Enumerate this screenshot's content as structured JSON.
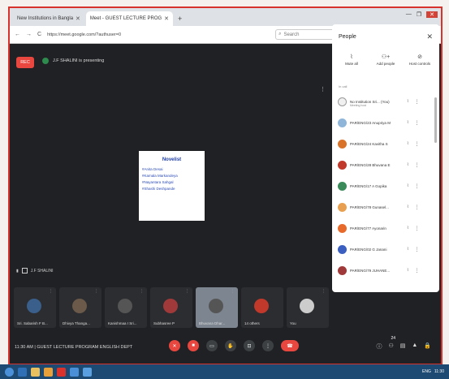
{
  "browser": {
    "tabs": [
      {
        "label": "New Institutions in Bangla",
        "active": false
      },
      {
        "label": "Meet - GUEST LECTURE PROG",
        "active": true
      }
    ],
    "new_tab": "+",
    "window_controls": [
      "—",
      "❐",
      "✕"
    ],
    "url": "https://meet.google.com/?authuser=0",
    "search_placeholder": "Search",
    "nav": [
      "←",
      "→",
      "C"
    ]
  },
  "meet": {
    "record_label": "REC",
    "presenting_text": "J.F SHALINI is presenting",
    "presenter_tag": "J.F SHALINI",
    "slide": {
      "title": "Novelist",
      "items": [
        "#Anita Desai",
        "#Kamala Markandeya",
        "#Nayantara Sahgal",
        "#Shashi Deshpande"
      ]
    },
    "tiles": [
      {
        "name": "Sri. Sabarish F B...",
        "color": "#3a5f8a"
      },
      {
        "name": "Dhivya Thanga...",
        "color": "#6b5a4a"
      },
      {
        "name": "Kanishmaa I Sri...",
        "color": "#555555"
      },
      {
        "name": "Subhasree P",
        "color": "#a03a3a"
      },
      {
        "name": "Bhuvana Dhar...",
        "color": "#7c8590"
      },
      {
        "name": "14 others",
        "color": "#c0392b"
      },
      {
        "name": "You",
        "color": "#cccccc"
      }
    ],
    "meeting_time": "11:30 AM",
    "meeting_title": "GUEST LECTURE PROGRAM ENGLISH DEPT",
    "people_count": "24"
  },
  "people_panel": {
    "title": "People",
    "actions": [
      {
        "icon": "mute-all-icon",
        "label": "Mute all"
      },
      {
        "icon": "add-people-icon",
        "label": "Add people"
      },
      {
        "icon": "host-controls-icon",
        "label": "Host controls"
      }
    ],
    "section_label": "In call",
    "participants": [
      {
        "name": "No Institution Sri... (You)",
        "sub": "Meeting host",
        "color": "#f0f0f0"
      },
      {
        "name": "PAR/ENG/23 Anupriya M",
        "sub": "",
        "color": "#8fb6d8"
      },
      {
        "name": "PAR/ENG/24 Kavitha S",
        "sub": "",
        "color": "#d9732a"
      },
      {
        "name": "PAR/ENG/28 Bhuvana E",
        "sub": "",
        "color": "#c0392b"
      },
      {
        "name": "PAR/ENG/17 A Gopika",
        "sub": "",
        "color": "#3a8a5a"
      },
      {
        "name": "PAR/ENG/78 Gunasel...",
        "sub": "",
        "color": "#e8a050"
      },
      {
        "name": "PAR/ENG/77 Ayonarin",
        "sub": "",
        "color": "#e86a2a"
      },
      {
        "name": "PAR/ENG/02 G Janani",
        "sub": "",
        "color": "#3b5fc0"
      },
      {
        "name": "PAR/ENG/79 JUHANE...",
        "sub": "",
        "color": "#a03a3a"
      }
    ]
  },
  "taskbar": {
    "icons": [
      "#4a90d9",
      "#2f6fb5",
      "#3b8be0",
      "#e8a03a",
      "#d9322c",
      "#4a90d9",
      "#5aa0e0"
    ],
    "tray_time": "11:30",
    "tray_lang": "ENG"
  }
}
